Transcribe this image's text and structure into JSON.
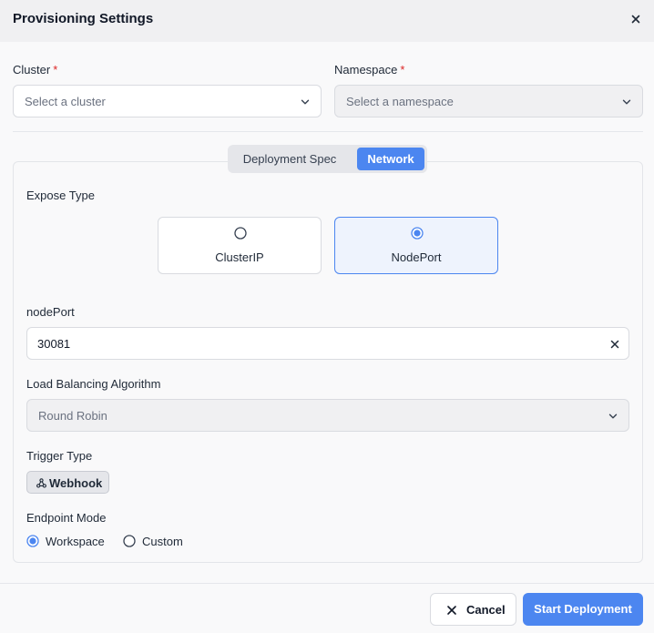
{
  "dialog": {
    "title": "Provisioning Settings"
  },
  "cluster": {
    "label": "Cluster",
    "required_mark": "*",
    "placeholder": "Select a cluster"
  },
  "namespace": {
    "label": "Namespace",
    "required_mark": "*",
    "placeholder": "Select a namespace"
  },
  "tabs": {
    "deployment_spec": "Deployment Spec",
    "network": "Network",
    "active": "Network"
  },
  "expose_type": {
    "label": "Expose Type",
    "options": [
      "ClusterIP",
      "NodePort"
    ],
    "selected": "NodePort"
  },
  "node_port": {
    "label": "nodePort",
    "value": "30081"
  },
  "load_balancing": {
    "label": "Load Balancing Algorithm",
    "value": "Round Robin"
  },
  "trigger_type": {
    "label": "Trigger Type",
    "badge": "Webhook",
    "badge_icon": "webhook-icon"
  },
  "endpoint_mode": {
    "label": "Endpoint Mode",
    "options": [
      "Workspace",
      "Custom"
    ],
    "selected": "Workspace"
  },
  "footer": {
    "cancel_label": "Cancel",
    "start_label": "Start Deployment"
  },
  "colors": {
    "accent": "#4c86f0",
    "required": "#dc2626",
    "header_bg": "#f0f0f2"
  }
}
